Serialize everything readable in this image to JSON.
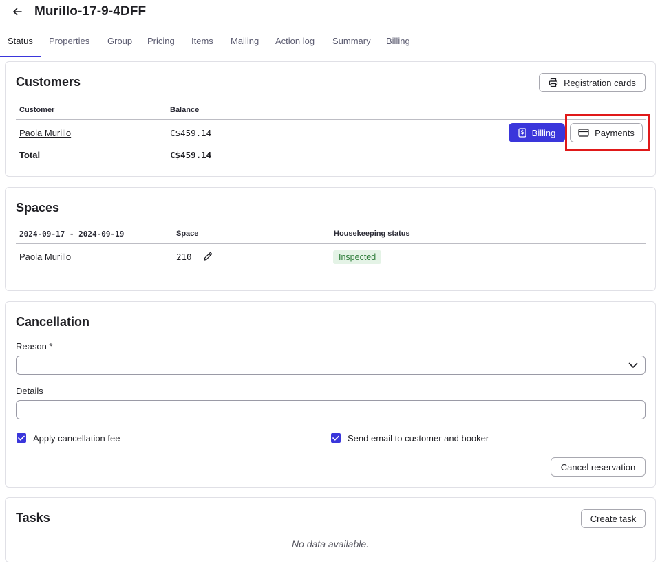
{
  "header": {
    "title": "Murillo-17-9-4DFF"
  },
  "tabs": [
    {
      "label": "Status"
    },
    {
      "label": "Properties"
    },
    {
      "label": "Group"
    },
    {
      "label": "Pricing"
    },
    {
      "label": "Items"
    },
    {
      "label": "Mailing"
    },
    {
      "label": "Action log"
    },
    {
      "label": "Summary"
    },
    {
      "label": "Billing"
    }
  ],
  "customers": {
    "title": "Customers",
    "registration_cards_label": "Registration cards",
    "columns": {
      "customer": "Customer",
      "balance": "Balance"
    },
    "rows": [
      {
        "customer": "Paola Murillo",
        "balance": "C$459.14",
        "billing_label": "Billing",
        "payments_label": "Payments"
      }
    ],
    "total": {
      "label": "Total",
      "value": "C$459.14"
    }
  },
  "spaces": {
    "title": "Spaces",
    "columns": {
      "dates": "2024-09-17 - 2024-09-19",
      "space": "Space",
      "housekeeping": "Housekeeping status"
    },
    "rows": [
      {
        "guest": "Paola Murillo",
        "space": "210",
        "housekeeping": "Inspected"
      }
    ]
  },
  "cancellation": {
    "title": "Cancellation",
    "reason_label": "Reason *",
    "reason_value": "",
    "details_label": "Details",
    "details_value": "",
    "apply_fee_label": "Apply cancellation fee",
    "apply_fee_checked": true,
    "send_email_label": "Send email to customer and booker",
    "send_email_checked": true,
    "cancel_button_label": "Cancel reservation"
  },
  "tasks": {
    "title": "Tasks",
    "create_button_label": "Create task",
    "empty_text": "No data available."
  },
  "colors": {
    "accent": "#3a36db",
    "highlight": "#e01919",
    "badge_bg": "#e4f3e6",
    "badge_text": "#2e7d3a"
  }
}
